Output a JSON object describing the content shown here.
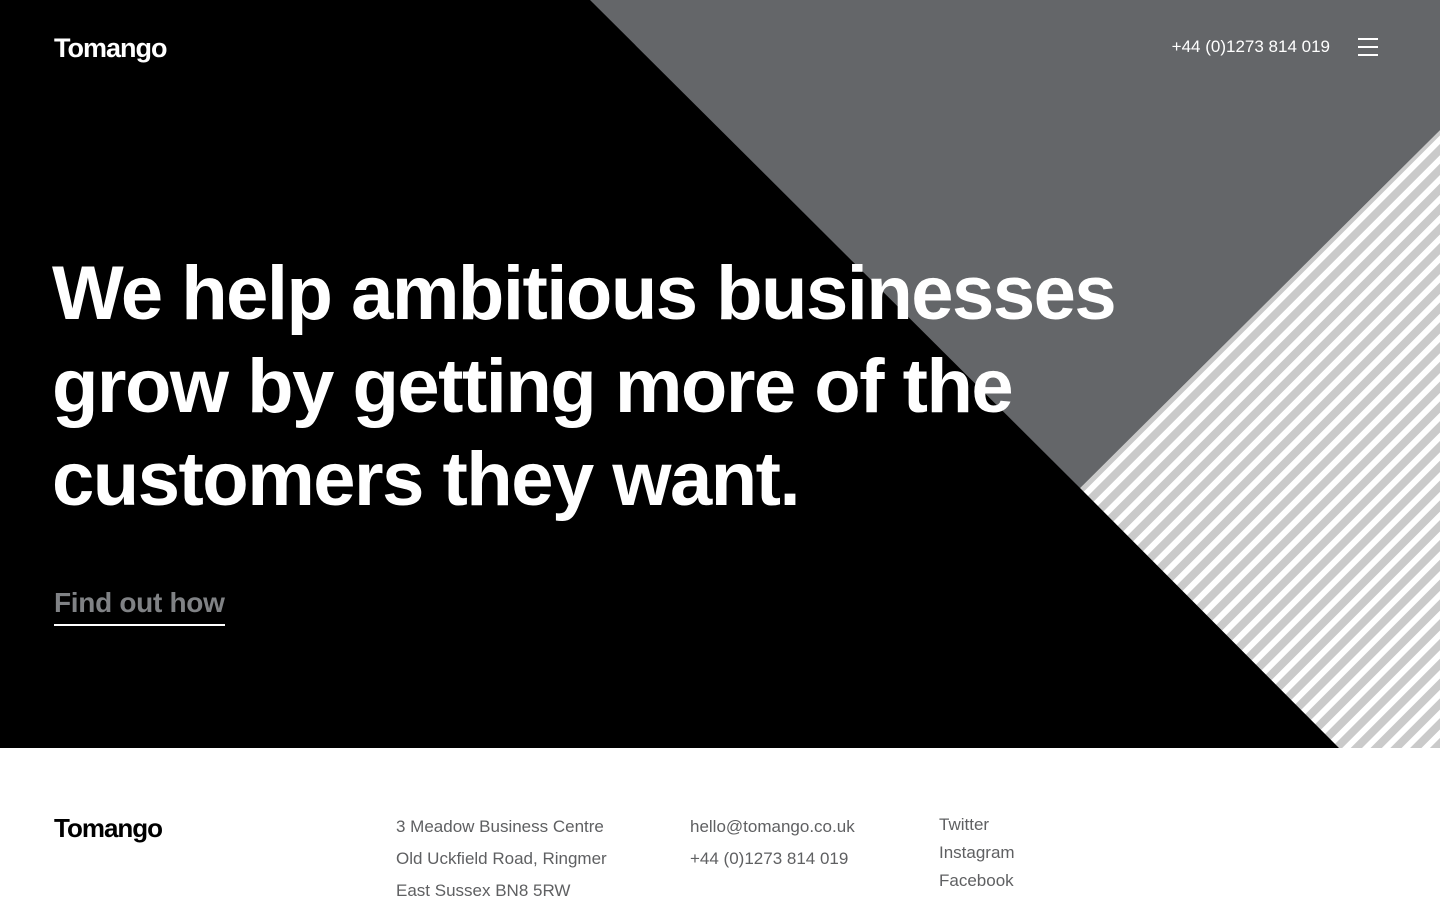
{
  "header": {
    "logo": "Tomango",
    "phone": "+44 (0)1273 814 019",
    "menu_icon": "hamburger-menu-icon"
  },
  "hero": {
    "headline_lines": [
      "We help ambitious businesses",
      "grow by getting more of the",
      "customers they want."
    ],
    "cta_label": "Find out how"
  },
  "footer": {
    "logo": "Tomango",
    "address": [
      "3 Meadow Business Centre",
      "Old Uckfield Road, Ringmer",
      "East Sussex BN8 5RW"
    ],
    "contact": {
      "email": "hello@tomango.co.uk",
      "phone": "+44 (0)1273 814 019"
    },
    "social": [
      "Twitter",
      "Instagram",
      "Facebook"
    ]
  },
  "colors": {
    "hero_background": "#000000",
    "triangle_grey": "#646669",
    "stripe_light": "#cacaca",
    "cta_text": "#808285",
    "footer_text": "#5f6062"
  }
}
